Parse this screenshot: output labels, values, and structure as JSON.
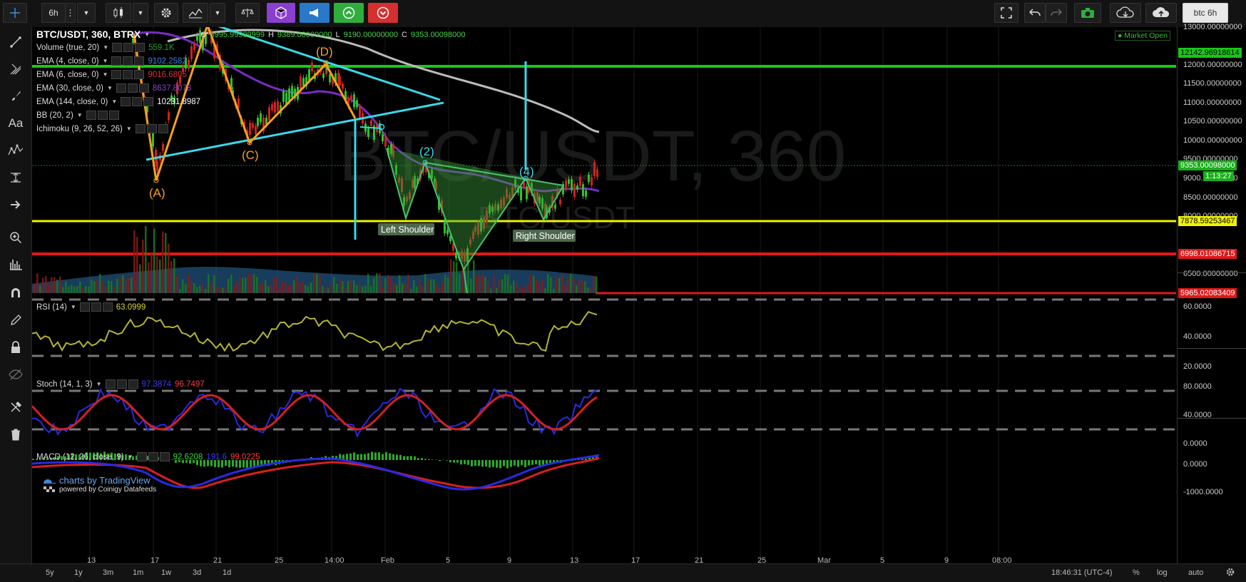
{
  "toolbar": {
    "interval": "6h",
    "symbol_search": "btc 6h"
  },
  "chart": {
    "symbol_line": "BTC/USDT, 360, BTRX",
    "ohlc": {
      "o_label": "O",
      "o": "8995.99999999",
      "h_label": "H",
      "h": "9389.00000000",
      "l_label": "L",
      "l": "9190.00000000",
      "c_label": "C",
      "c": "9353.00098000"
    },
    "market_status": "● Market Open",
    "watermark": "BTC/USDT, 360",
    "watermark2": "BTC/USDT",
    "indicators": [
      {
        "label": "Volume (true, 20)",
        "value": "559.1K",
        "color": "#2a9d2a"
      },
      {
        "label": "EMA (4, close, 0)",
        "value": "9102.2582",
        "color": "#3d7bd9"
      },
      {
        "label": "EMA (6, close, 0)",
        "value": "9016.6805",
        "color": "#e03030"
      },
      {
        "label": "EMA (30, close, 0)",
        "value": "8637.8078",
        "color": "#8844cc"
      },
      {
        "label": "EMA (144, close, 0)",
        "value": "10231.8987",
        "color": "#ffffff"
      },
      {
        "label": "BB (20, 2)",
        "value": "",
        "color": "#3d7bd9"
      },
      {
        "label": "Ichimoku (9, 26, 52, 26)",
        "value": "",
        "color": "#ccc"
      }
    ],
    "annotations": {
      "A": "(A)",
      "C": "(C)",
      "D": "(D)",
      "wave2": "(2)",
      "wave4": "(4)",
      "left_shoulder": "Left Shoulder",
      "right_shoulder": "Right Shoulder"
    },
    "branding": {
      "line1": "charts by TradingView",
      "line2": "powered by Coinigy Datafeeds"
    }
  },
  "price_axis": {
    "labels": [
      "13000.00000000",
      "12000.00000000",
      "11500.00000000",
      "11000.00000000",
      "10500.00000000",
      "10000.00000000",
      "9500.00000000",
      "9000.00000000",
      "8500.00000000",
      "8000.00000000",
      "6500.00000000"
    ],
    "badges": [
      {
        "text": "12142.96918614",
        "bg": "#18c818",
        "fg": "#000"
      },
      {
        "text": "9353.00098000",
        "bg": "#18b018",
        "fg": "#fff"
      },
      {
        "text": "1:13:27",
        "bg": "#18b018",
        "fg": "#fff"
      },
      {
        "text": "7878.59253467",
        "bg": "#f2f200",
        "fg": "#000"
      },
      {
        "text": "6998.01086715",
        "bg": "#e01818",
        "fg": "#fff"
      },
      {
        "text": "5965.02083409",
        "bg": "#e01818",
        "fg": "#fff"
      }
    ]
  },
  "rsi": {
    "label": "RSI (14)",
    "value": "63.0999",
    "axis": [
      "60.0000",
      "40.0000",
      "20.0000"
    ]
  },
  "stoch": {
    "label": "Stoch (14, 1, 3)",
    "k": "97.3874",
    "d": "96.7497",
    "axis": [
      "80.0000",
      "40.0000",
      "0.0000"
    ]
  },
  "macd": {
    "label": "MACD (12, 26, close, 9)",
    "hist": "92.6208",
    "macd": "191.6",
    "signal": "99.0225",
    "axis": [
      "0.0000",
      "-1000.0000"
    ]
  },
  "time_axis": [
    "13",
    "17",
    "21",
    "25",
    "14:00",
    "Feb",
    "5",
    "9",
    "13",
    "17",
    "21",
    "25",
    "Mar",
    "5",
    "9",
    "08:00"
  ],
  "bottom": {
    "ranges": [
      "5y",
      "1y",
      "3m",
      "1m",
      "1w",
      "3d",
      "1d"
    ],
    "clock": "18:46:31 (UTC-4)",
    "percent": "%",
    "log": "log",
    "auto": "auto"
  }
}
